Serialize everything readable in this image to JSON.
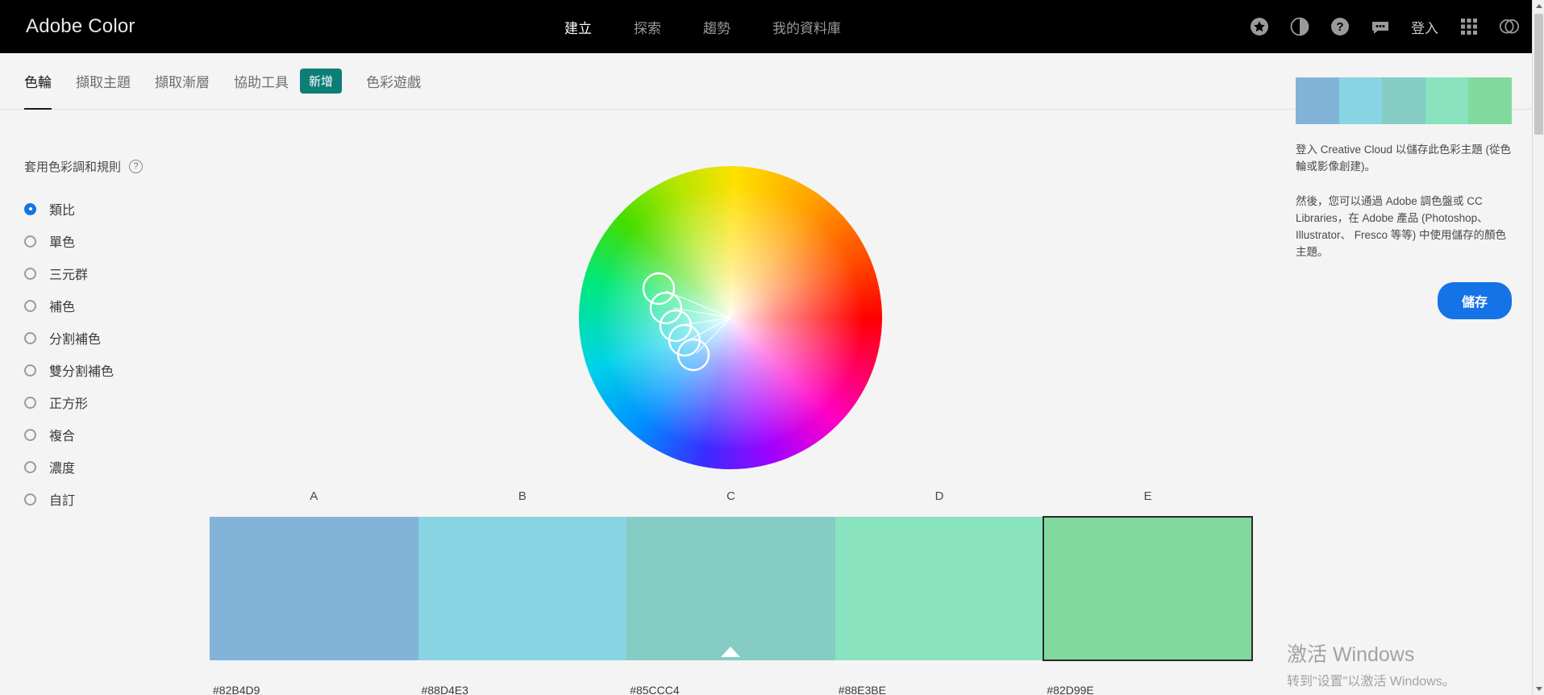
{
  "topbar": {
    "brand": "Adobe Color",
    "nav": [
      {
        "label": "建立",
        "active": true
      },
      {
        "label": "探索",
        "active": false
      },
      {
        "label": "趨勢",
        "active": false
      },
      {
        "label": "我的資料庫",
        "active": false
      }
    ],
    "icons": [
      "star-icon",
      "contrast-icon",
      "help-circle-icon",
      "chat-bubble-icon"
    ],
    "signin_label": "登入",
    "apps_icon": "grid-apps-icon",
    "cc_icon": "creative-cloud-icon"
  },
  "tabs": [
    {
      "label": "色輪",
      "active": true
    },
    {
      "label": "擷取主題",
      "active": false
    },
    {
      "label": "擷取漸層",
      "active": false
    },
    {
      "label": "協助工具",
      "active": false
    },
    {
      "label": "色彩遊戲",
      "active": false
    }
  ],
  "new_badge": "新增",
  "harmony": {
    "title": "套用色彩調和規則",
    "help_icon": "?",
    "options": [
      {
        "label": "類比",
        "selected": true
      },
      {
        "label": "單色",
        "selected": false
      },
      {
        "label": "三元群",
        "selected": false
      },
      {
        "label": "補色",
        "selected": false
      },
      {
        "label": "分割補色",
        "selected": false
      },
      {
        "label": "雙分割補色",
        "selected": false
      },
      {
        "label": "正方形",
        "selected": false
      },
      {
        "label": "複合",
        "selected": false
      },
      {
        "label": "濃度",
        "selected": false
      },
      {
        "label": "自訂",
        "selected": false
      }
    ]
  },
  "swatches": [
    {
      "letter": "A",
      "hex": "#82B4D9",
      "selected": false,
      "base": false
    },
    {
      "letter": "B",
      "hex": "#88D4E3",
      "selected": false,
      "base": false
    },
    {
      "letter": "C",
      "hex": "#85CCC4",
      "selected": false,
      "base": true
    },
    {
      "letter": "D",
      "hex": "#88E3BE",
      "selected": false,
      "base": false
    },
    {
      "letter": "E",
      "hex": "#82D99E",
      "selected": true,
      "base": false
    }
  ],
  "right_panel": {
    "paragraph1": "登入 Creative Cloud 以儲存此色彩主題 (從色輪或影像創建)。",
    "paragraph2": "然後，您可以通過 Adobe 調色盤或 CC Libraries，在 Adobe 產品 (Photoshop、Illustrator、 Fresco 等等) 中使用儲存的顏色主題。",
    "save_label": "儲存"
  },
  "watermark": {
    "title": "激活 Windows",
    "subtitle": "转到\"设置\"以激活 Windows。"
  },
  "colors": {
    "accent_blue": "#1473E6",
    "badge_teal": "#0D7D77",
    "topbar_bg": "#000000",
    "page_bg": "#F4F4F4"
  }
}
